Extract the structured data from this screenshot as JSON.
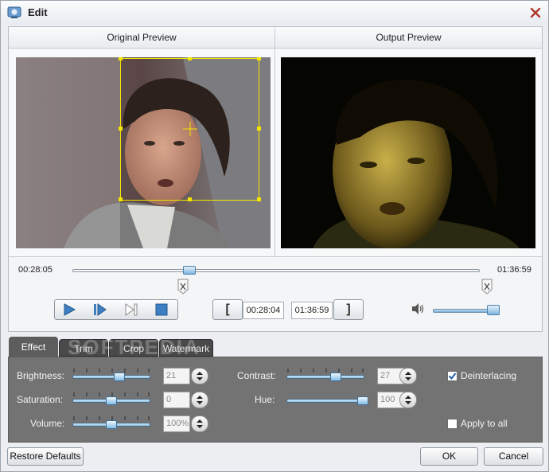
{
  "window": {
    "title": "Edit"
  },
  "preview": {
    "original_label": "Original Preview",
    "output_label": "Output Preview"
  },
  "timeline": {
    "start_time": "00:28:05",
    "end_time": "01:36:59",
    "trim_start": "00:28:04",
    "trim_end": "01:36:59",
    "trim_start_button": "[",
    "trim_end_button": "]",
    "seek_position_fraction": 0.288,
    "volume_fraction": 0.95
  },
  "tabs": [
    "Effect",
    "Trim",
    "Crop",
    "Watermark"
  ],
  "active_tab": "Effect",
  "watermark_overlay": "SOFTPEDIA",
  "effect": {
    "brightness": {
      "label": "Brightness:",
      "value": "21"
    },
    "saturation": {
      "label": "Saturation:",
      "value": "0"
    },
    "volume": {
      "label": "Volume:",
      "value": "100%"
    },
    "contrast": {
      "label": "Contrast:",
      "value": "27"
    },
    "hue": {
      "label": "Hue:",
      "value": "100"
    },
    "deinterlacing": {
      "label": "Deinterlacing",
      "checked": true
    },
    "apply_to_all": {
      "label": "Apply to all",
      "checked": false
    }
  },
  "buttons": {
    "restore": "Restore Defaults",
    "ok": "OK",
    "cancel": "Cancel"
  },
  "colors": {
    "accent": "#4a86c8",
    "panel_bg": "#737373",
    "crop_box": "#f2e600"
  }
}
